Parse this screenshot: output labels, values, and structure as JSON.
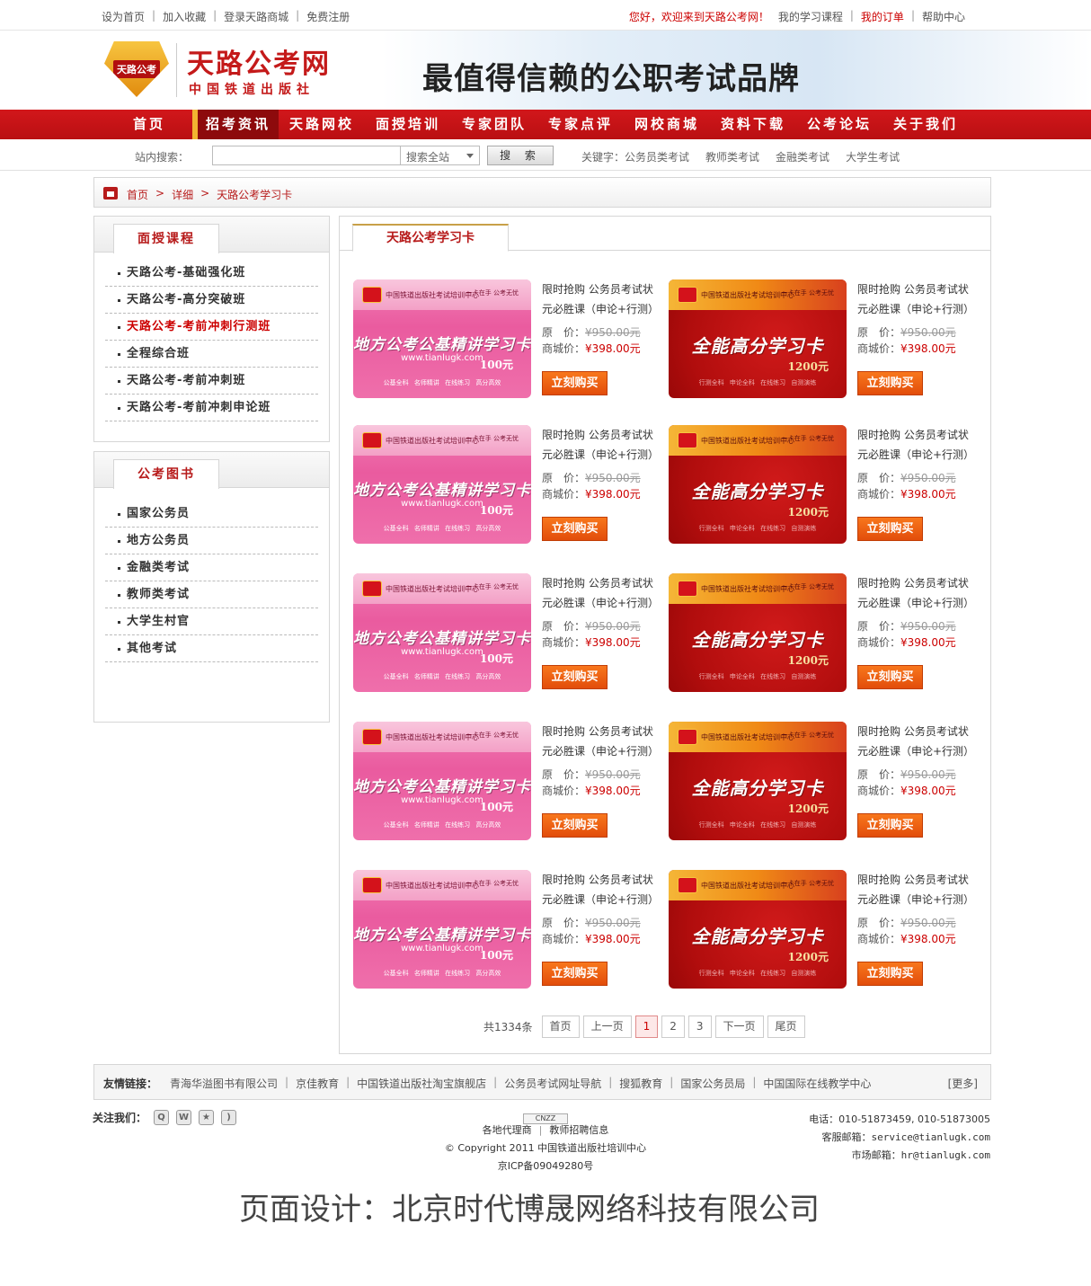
{
  "topbar": {
    "left": [
      "设为首页",
      "加入收藏",
      "登录天路商城",
      "免费注册"
    ],
    "welcome": "您好，欢迎来到天路公考网！",
    "right": [
      "我的学习课程",
      "我的订单",
      "帮助中心"
    ]
  },
  "header": {
    "logo_text": "天路公考",
    "brand": "天路公考网",
    "brand_sub": "中国铁道出版社",
    "slogan": "最值得信赖的公职考试品牌"
  },
  "nav": [
    "首页",
    "招考资讯",
    "天路网校",
    "面授培训",
    "专家团队",
    "专家点评",
    "网校商城",
    "资料下载",
    "公考论坛",
    "关于我们"
  ],
  "search": {
    "label": "站内搜索：",
    "input_value": "",
    "select": "搜索全站",
    "button": "搜 索",
    "keywords_label": "关键字：",
    "keywords": [
      "公务员类考试",
      "教师类考试",
      "金融类考试",
      "大学生考试"
    ]
  },
  "breadcrumb": [
    "首页",
    "详细",
    "天路公考学习卡"
  ],
  "sidebar1": {
    "title": "面授课程",
    "items": [
      "天路公考-基础强化班",
      "天路公考-高分突破班",
      "天路公考-考前冲刺行测班",
      "全程综合班",
      "天路公考-考前冲刺班",
      "天路公考-考前冲刺申论班"
    ]
  },
  "sidebar2": {
    "title": "公考图书",
    "items": [
      "国家公务员",
      "地方公务员",
      "金融类考试",
      "教师类考试",
      "大学生村官",
      "其他考试"
    ]
  },
  "main": {
    "tab": "天路公考学习卡",
    "product": {
      "title": "限时抢购 公务员考试状元必胜课（申论+行测）",
      "orig_label": "原　价：",
      "orig_price": "¥950.00元",
      "price_label": "商城价：",
      "price": "¥398.00元",
      "buy": "立刻购买"
    },
    "cards": {
      "pink": {
        "org": "中国铁道出版社考试培训中心",
        "corner": "一卡在手 公考无忧",
        "title": "地方公考公基精讲学习卡",
        "url": "www.tianlugk.com",
        "amount": "100元",
        "feats": "公基全科 名师精讲 在线练习 高分高效"
      },
      "red": {
        "org": "中国铁道出版社考试培训中心",
        "corner": "一卡在手 公考无忧",
        "title": "全能高分学习卡",
        "amount": "1200元",
        "feats": "行测全科 申论全科 在线练习 自测演练"
      }
    }
  },
  "pager": {
    "total": "共1334条",
    "items": [
      "首页",
      "上一页",
      "1",
      "2",
      "3",
      "下一页",
      "尾页"
    ],
    "current": "1"
  },
  "links": {
    "label": "友情链接：",
    "items": [
      "青海华溢图书有限公司",
      "京佳教育",
      "中国铁道出版社淘宝旗舰店",
      "公务员考试网址导航",
      "搜狐教育",
      "国家公务员局",
      "中国国际在线教学中心"
    ],
    "more": "[更多]"
  },
  "footer": {
    "follow": "关注我们：",
    "cnzz": "CNZZ",
    "links": [
      "各地代理商",
      "教师招聘信息"
    ],
    "copyright": "© Copyright 2011 中国铁道出版社培训中心",
    "icp": "京ICP备09049280号",
    "phone": "电话：010-51873459, 010-51873005",
    "service": "客服邮箱：service@tianlugk.com",
    "market": "市场邮箱：hr@tianlugk.com"
  },
  "credit": "页面设计：北京时代博晟网络科技有限公司"
}
